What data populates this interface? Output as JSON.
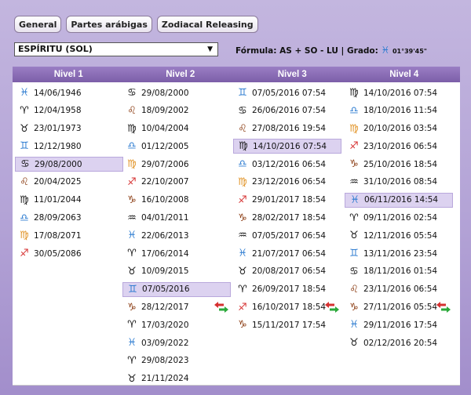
{
  "tabs": [
    "General",
    "Partes arábigas",
    "Zodiacal Releasing"
  ],
  "lot_select": {
    "value": "ESPÍRITU (SOL)"
  },
  "formula": {
    "label": "Fórmula: AS + SO - LU | Grado:",
    "glyph": "♓",
    "degree": "01°39'45\""
  },
  "headers": [
    "Nivel 1",
    "Nivel 2",
    "Nivel 3",
    "Nivel 4"
  ],
  "colors": {
    "red": "#d63030",
    "blue": "#2a7ad0",
    "orange": "#e09020",
    "brown": "#8a3a10",
    "black": "#111111"
  },
  "levels": [
    {
      "name": "Nivel 1",
      "rows": [
        {
          "sign": "♓",
          "color": "#2a7ad0",
          "date": "14/06/1946",
          "selected": false,
          "arrows": false
        },
        {
          "sign": "♈",
          "color": "#111111",
          "date": "12/04/1958",
          "selected": false,
          "arrows": false
        },
        {
          "sign": "♉",
          "color": "#111111",
          "date": "23/01/1973",
          "selected": false,
          "arrows": false
        },
        {
          "sign": "♊",
          "color": "#2a7ad0",
          "date": "12/12/1980",
          "selected": false,
          "arrows": false
        },
        {
          "sign": "♋",
          "color": "#111111",
          "date": "29/08/2000",
          "selected": true,
          "arrows": false
        },
        {
          "sign": "♌",
          "color": "#8a3a10",
          "date": "20/04/2025",
          "selected": false,
          "arrows": false
        },
        {
          "sign": "♍",
          "color": "#111111",
          "date": "11/01/2044",
          "selected": false,
          "arrows": false
        },
        {
          "sign": "♎",
          "color": "#2a7ad0",
          "date": "28/09/2063",
          "selected": false,
          "arrows": false
        },
        {
          "sign": "♍",
          "color": "#e09020",
          "date": "17/08/2071",
          "selected": false,
          "arrows": false
        },
        {
          "sign": "♐",
          "color": "#d63030",
          "date": "30/05/2086",
          "selected": false,
          "arrows": false
        }
      ]
    },
    {
      "name": "Nivel 2",
      "rows": [
        {
          "sign": "♋",
          "color": "#111111",
          "date": "29/08/2000",
          "selected": false,
          "arrows": false
        },
        {
          "sign": "♌",
          "color": "#8a3a10",
          "date": "18/09/2002",
          "selected": false,
          "arrows": false
        },
        {
          "sign": "♍",
          "color": "#111111",
          "date": "10/04/2004",
          "selected": false,
          "arrows": false
        },
        {
          "sign": "♎",
          "color": "#2a7ad0",
          "date": "01/12/2005",
          "selected": false,
          "arrows": false
        },
        {
          "sign": "♍",
          "color": "#e09020",
          "date": "29/07/2006",
          "selected": false,
          "arrows": false
        },
        {
          "sign": "♐",
          "color": "#d63030",
          "date": "22/10/2007",
          "selected": false,
          "arrows": false
        },
        {
          "sign": "♑",
          "color": "#8a3a10",
          "date": "16/10/2008",
          "selected": false,
          "arrows": false
        },
        {
          "sign": "♒",
          "color": "#111111",
          "date": "04/01/2011",
          "selected": false,
          "arrows": false
        },
        {
          "sign": "♓",
          "color": "#2a7ad0",
          "date": "22/06/2013",
          "selected": false,
          "arrows": false
        },
        {
          "sign": "♈",
          "color": "#111111",
          "date": "17/06/2014",
          "selected": false,
          "arrows": false
        },
        {
          "sign": "♉",
          "color": "#111111",
          "date": "10/09/2015",
          "selected": false,
          "arrows": false
        },
        {
          "sign": "♊",
          "color": "#2a7ad0",
          "date": "07/05/2016",
          "selected": true,
          "arrows": false
        },
        {
          "sign": "♑",
          "color": "#8a3a10",
          "date": "28/12/2017",
          "selected": false,
          "arrows": true
        },
        {
          "sign": "♈",
          "color": "#111111",
          "date": "17/03/2020",
          "selected": false,
          "arrows": false
        },
        {
          "sign": "♓",
          "color": "#2a7ad0",
          "date": "03/09/2022",
          "selected": false,
          "arrows": false
        },
        {
          "sign": "♈",
          "color": "#111111",
          "date": "29/08/2023",
          "selected": false,
          "arrows": false
        },
        {
          "sign": "♉",
          "color": "#111111",
          "date": "21/11/2024",
          "selected": false,
          "arrows": false
        }
      ]
    },
    {
      "name": "Nivel 3",
      "rows": [
        {
          "sign": "♊",
          "color": "#2a7ad0",
          "date": "07/05/2016 07:54",
          "selected": false,
          "arrows": false
        },
        {
          "sign": "♋",
          "color": "#111111",
          "date": "26/06/2016 07:54",
          "selected": false,
          "arrows": false
        },
        {
          "sign": "♌",
          "color": "#8a3a10",
          "date": "27/08/2016 19:54",
          "selected": false,
          "arrows": false
        },
        {
          "sign": "♍",
          "color": "#111111",
          "date": "14/10/2016 07:54",
          "selected": true,
          "arrows": false
        },
        {
          "sign": "♎",
          "color": "#2a7ad0",
          "date": "03/12/2016 06:54",
          "selected": false,
          "arrows": false
        },
        {
          "sign": "♍",
          "color": "#e09020",
          "date": "23/12/2016 06:54",
          "selected": false,
          "arrows": false
        },
        {
          "sign": "♐",
          "color": "#d63030",
          "date": "29/01/2017 18:54",
          "selected": false,
          "arrows": false
        },
        {
          "sign": "♑",
          "color": "#8a3a10",
          "date": "28/02/2017 18:54",
          "selected": false,
          "arrows": false
        },
        {
          "sign": "♒",
          "color": "#111111",
          "date": "07/05/2017 06:54",
          "selected": false,
          "arrows": false
        },
        {
          "sign": "♓",
          "color": "#2a7ad0",
          "date": "21/07/2017 06:54",
          "selected": false,
          "arrows": false
        },
        {
          "sign": "♉",
          "color": "#111111",
          "date": "20/08/2017 06:54",
          "selected": false,
          "arrows": false
        },
        {
          "sign": "♈",
          "color": "#111111",
          "date": "26/09/2017 18:54",
          "selected": false,
          "arrows": false
        },
        {
          "sign": "♐",
          "color": "#d63030",
          "date": "16/10/2017 18:54",
          "selected": false,
          "arrows": true
        },
        {
          "sign": "♑",
          "color": "#8a3a10",
          "date": "15/11/2017 17:54",
          "selected": false,
          "arrows": false
        }
      ]
    },
    {
      "name": "Nivel 4",
      "rows": [
        {
          "sign": "♍",
          "color": "#111111",
          "date": "14/10/2016 07:54",
          "selected": false,
          "arrows": false
        },
        {
          "sign": "♎",
          "color": "#2a7ad0",
          "date": "18/10/2016 11:54",
          "selected": false,
          "arrows": false
        },
        {
          "sign": "♍",
          "color": "#e09020",
          "date": "20/10/2016 03:54",
          "selected": false,
          "arrows": false
        },
        {
          "sign": "♐",
          "color": "#d63030",
          "date": "23/10/2016 06:54",
          "selected": false,
          "arrows": false
        },
        {
          "sign": "♑",
          "color": "#8a3a10",
          "date": "25/10/2016 18:54",
          "selected": false,
          "arrows": false
        },
        {
          "sign": "♒",
          "color": "#111111",
          "date": "31/10/2016 08:54",
          "selected": false,
          "arrows": false
        },
        {
          "sign": "♓",
          "color": "#2a7ad0",
          "date": "06/11/2016 14:54",
          "selected": true,
          "arrows": false
        },
        {
          "sign": "♈",
          "color": "#111111",
          "date": "09/11/2016 02:54",
          "selected": false,
          "arrows": false
        },
        {
          "sign": "♉",
          "color": "#111111",
          "date": "12/11/2016 05:54",
          "selected": false,
          "arrows": false
        },
        {
          "sign": "♊",
          "color": "#2a7ad0",
          "date": "13/11/2016 23:54",
          "selected": false,
          "arrows": false
        },
        {
          "sign": "♋",
          "color": "#111111",
          "date": "18/11/2016 01:54",
          "selected": false,
          "arrows": false
        },
        {
          "sign": "♌",
          "color": "#8a3a10",
          "date": "23/11/2016 06:54",
          "selected": false,
          "arrows": false
        },
        {
          "sign": "♑",
          "color": "#8a3a10",
          "date": "27/11/2016 05:54",
          "selected": false,
          "arrows": true
        },
        {
          "sign": "♓",
          "color": "#2a7ad0",
          "date": "29/11/2016 17:54",
          "selected": false,
          "arrows": false
        },
        {
          "sign": "♉",
          "color": "#111111",
          "date": "02/12/2016 20:54",
          "selected": false,
          "arrows": false
        }
      ]
    }
  ]
}
